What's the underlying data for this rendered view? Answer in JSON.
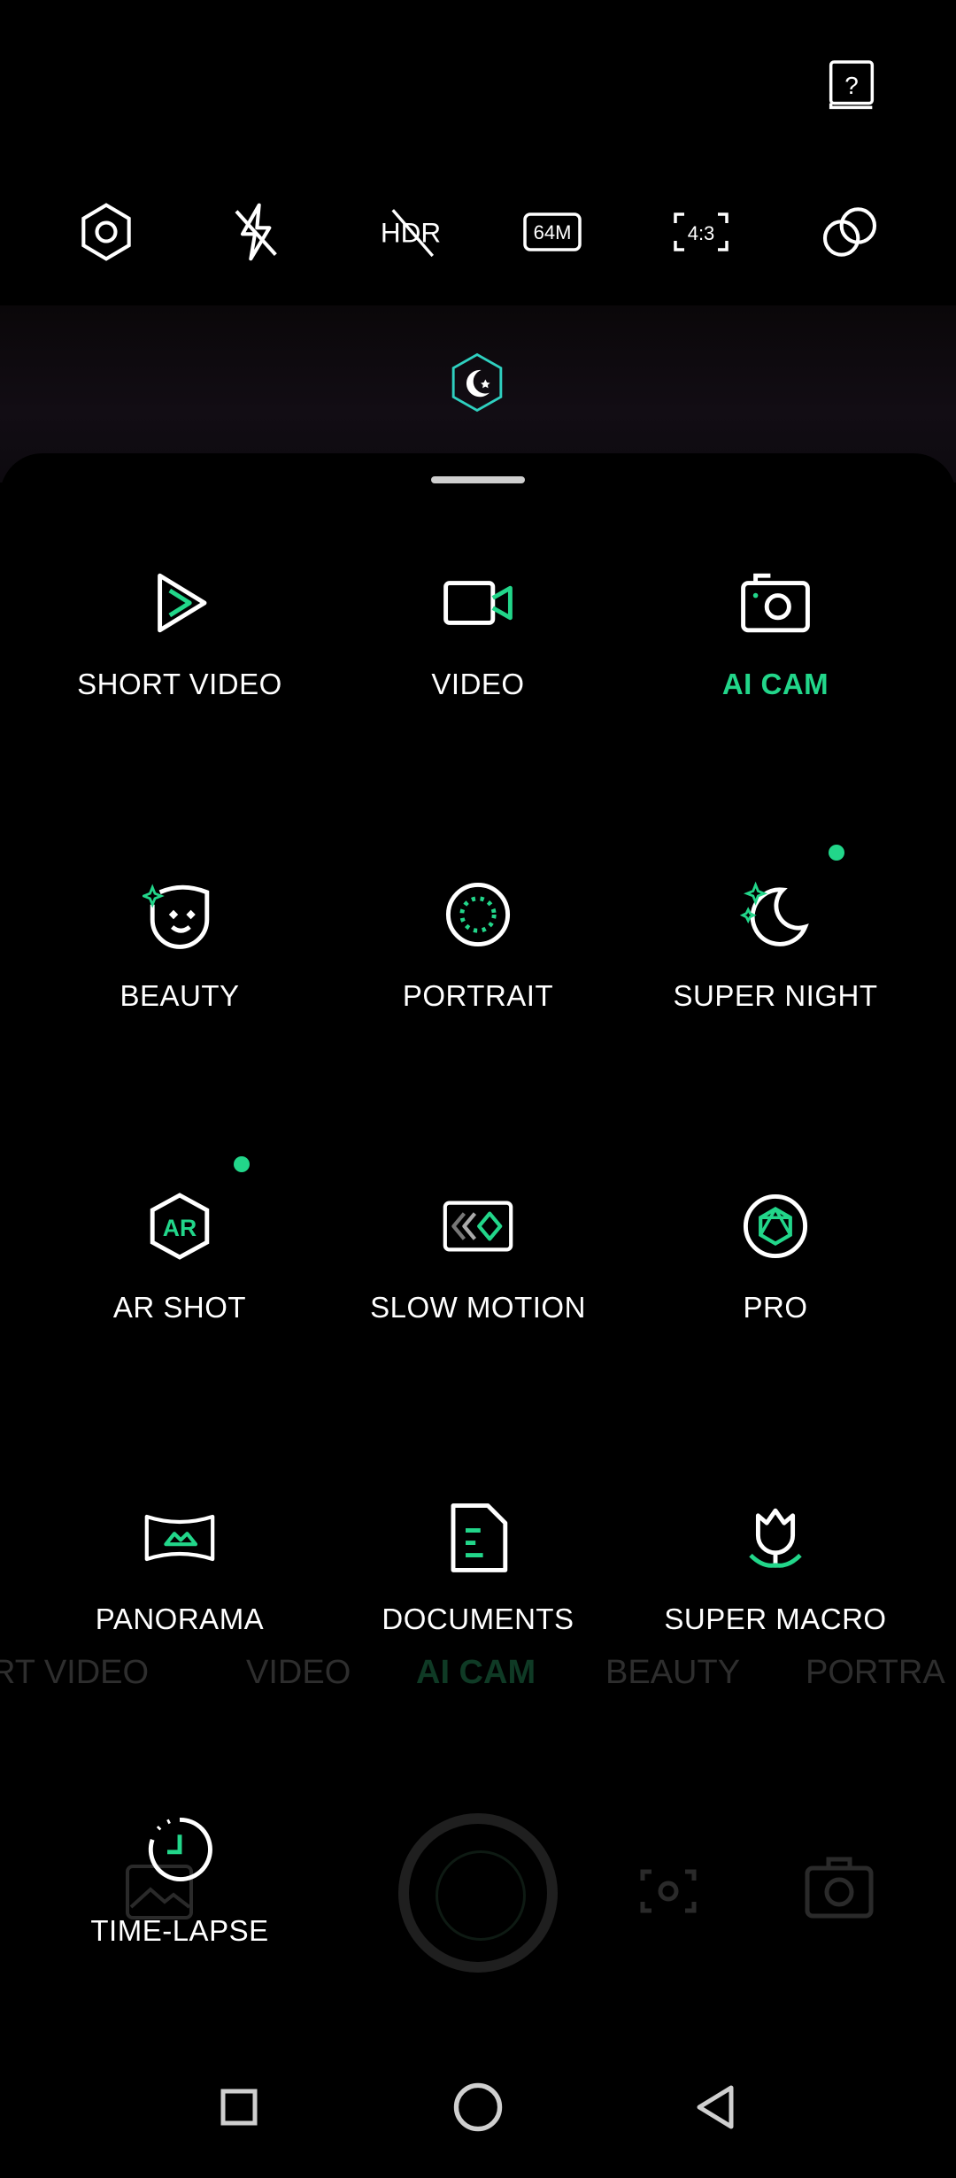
{
  "top_bar": {
    "help_icon": "help-book-icon",
    "settings_icon": "hexagon-settings-icon",
    "flash_icon": "flash-off-icon",
    "hdr_label": "HDR",
    "resolution_label": "64M",
    "ratio_label": "4:3",
    "filter_icon": "filter-circles-icon"
  },
  "scene_badge": "night-scene-icon",
  "modes": [
    {
      "label": "SHORT VIDEO",
      "icon": "play-triangle-icon",
      "active": false
    },
    {
      "label": "VIDEO",
      "icon": "video-camera-icon",
      "active": false
    },
    {
      "label": "AI CAM",
      "icon": "camera-icon",
      "active": true
    },
    {
      "label": "BEAUTY",
      "icon": "face-smile-icon",
      "active": false
    },
    {
      "label": "PORTRAIT",
      "icon": "portrait-circle-icon",
      "active": false
    },
    {
      "label": "SUPER NIGHT",
      "icon": "moon-stars-icon",
      "active": false,
      "new_dot": true
    },
    {
      "label": "AR SHOT",
      "icon": "ar-hexagon-icon",
      "active": false,
      "new_dot": true
    },
    {
      "label": "SLOW MOTION",
      "icon": "slow-motion-icon",
      "active": false
    },
    {
      "label": "PRO",
      "icon": "aperture-icon",
      "active": false
    },
    {
      "label": "PANORAMA",
      "icon": "panorama-icon",
      "active": false
    },
    {
      "label": "DOCUMENTS",
      "icon": "document-icon",
      "active": false
    },
    {
      "label": "SUPER MACRO",
      "icon": "tulip-macro-icon",
      "active": false
    },
    {
      "label": "TIME-LAPSE",
      "icon": "timer-icon",
      "active": false
    }
  ],
  "background_mode_strip": [
    "RT VIDEO",
    "VIDEO",
    "AI CAM",
    "BEAUTY",
    "PORTRA"
  ],
  "colors": {
    "accent": "#22d68a",
    "background": "#000000",
    "text": "#ffffff"
  },
  "nav": {
    "recent": "square-icon",
    "home": "circle-icon",
    "back": "triangle-back-icon"
  }
}
